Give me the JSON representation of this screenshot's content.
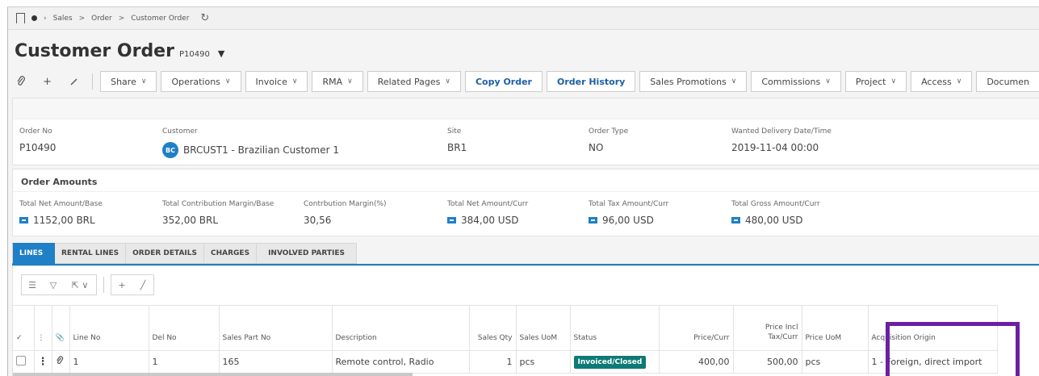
{
  "breadcrumb": {
    "items": [
      "Sales",
      "Order",
      "Customer Order"
    ],
    "separator": ">",
    "icons": [
      "bookmark-icon",
      "home-dot-icon",
      "refresh-icon"
    ]
  },
  "page": {
    "title": "Customer Order",
    "subtitle": "P10490",
    "caret": "▼"
  },
  "toolbar": {
    "icons": [
      "attachment-icon",
      "add-icon",
      "edit-icon"
    ],
    "buttons": [
      {
        "label": "Share",
        "dropdown": true
      },
      {
        "label": "Operations",
        "dropdown": true
      },
      {
        "label": "Invoice",
        "dropdown": true
      },
      {
        "label": "RMA",
        "dropdown": true
      },
      {
        "label": "Related Pages",
        "dropdown": true
      },
      {
        "label": "Copy Order",
        "dropdown": false
      },
      {
        "label": "Order History",
        "dropdown": false
      },
      {
        "label": "Sales Promotions",
        "dropdown": true
      },
      {
        "label": "Commissions",
        "dropdown": true
      },
      {
        "label": "Project",
        "dropdown": true
      },
      {
        "label": "Access",
        "dropdown": true
      },
      {
        "label": "Documen",
        "dropdown": false
      }
    ]
  },
  "order": {
    "fields": [
      {
        "label": "Order No",
        "value": "P10490"
      },
      {
        "label": "Customer",
        "value": "BRCUST1 - Brazilian Customer 1",
        "badge": "BC"
      },
      {
        "label": "Site",
        "value": "BR1"
      },
      {
        "label": "Order Type",
        "value": "NO"
      },
      {
        "label": "Wanted Delivery Date/Time",
        "value": "2019-11-04 00:00"
      }
    ]
  },
  "amounts": {
    "heading": "Order Amounts",
    "fields": [
      {
        "label": "Total Net Amount/Base",
        "value": "1152,00 BRL",
        "icon": true
      },
      {
        "label": "Total Contribution Margin/Base",
        "value": "352,00 BRL",
        "icon": false
      },
      {
        "label": "Contrbution Margin(%)",
        "value": "30,56",
        "icon": false
      },
      {
        "label": "Total Net Amount/Curr",
        "value": "384,00 USD",
        "icon": true
      },
      {
        "label": "Total Tax Amount/Curr",
        "value": "96,00 USD",
        "icon": true
      },
      {
        "label": "Total Gross Amount/Curr",
        "value": "480,00 USD",
        "icon": true
      }
    ]
  },
  "tabs": [
    "LINES",
    "RENTAL LINES",
    "ORDER DETAILS",
    "CHARGES",
    "INVOLVED PARTIES"
  ],
  "active_tab": "LINES",
  "grid": {
    "columns": [
      {
        "label": "✓"
      },
      {
        "label": "⋮"
      },
      {
        "label": "📎"
      },
      {
        "label": "Line No"
      },
      {
        "label": "Del No"
      },
      {
        "label": "Sales Part No"
      },
      {
        "label": "Description"
      },
      {
        "label": "Sales Qty"
      },
      {
        "label": "Sales UoM"
      },
      {
        "label": "Status"
      },
      {
        "label": "Price/Curr"
      },
      {
        "label": "Price Incl Tax/Curr"
      },
      {
        "label": "Price UoM"
      },
      {
        "label": "Acquisition Origin"
      }
    ],
    "rows": [
      {
        "line_no": "1",
        "del_no": "1",
        "sales_part_no": "165",
        "description": "Remote control, Radio",
        "sales_qty": "1",
        "sales_uom": "pcs",
        "status": "Invoiced/Closed",
        "price_curr": "400,00",
        "price_incl_tax_curr": "500,00",
        "price_uom": "pcs",
        "acquisition_origin": "1 - Foreign, direct import"
      }
    ]
  },
  "colors": {
    "accent": "#1f7fc7",
    "status_bg": "#0d7a75",
    "highlight": "#6b1fa4"
  }
}
